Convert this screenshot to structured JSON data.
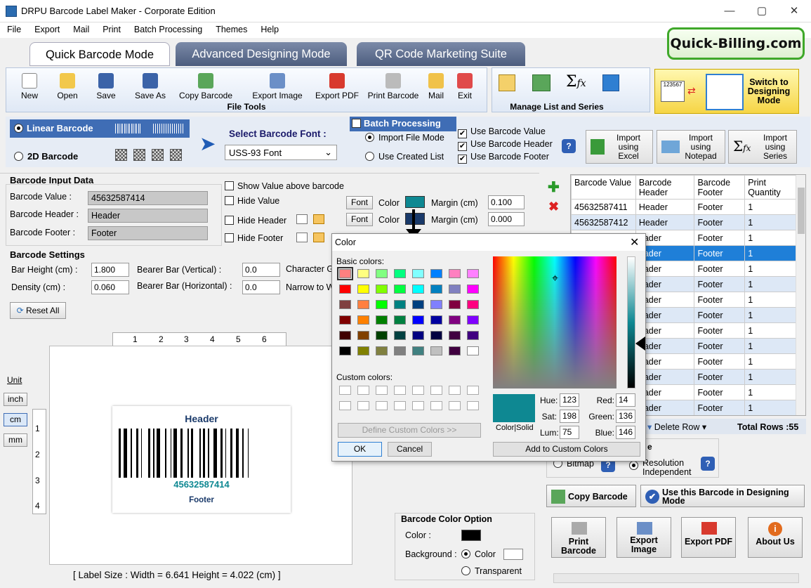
{
  "window": {
    "title": "DRPU Barcode Label Maker - Corporate Edition",
    "minimize": "—",
    "maximize": "▢",
    "close": "✕"
  },
  "menu": [
    "File",
    "Export",
    "Mail",
    "Print",
    "Batch Processing",
    "Themes",
    "Help"
  ],
  "tabs": [
    "Quick Barcode Mode",
    "Advanced Designing Mode",
    "QR Code Marketing Suite"
  ],
  "quick_billing": "Quick-Billing.com",
  "toolbar": {
    "items": [
      "New",
      "Open",
      "Save",
      "Save As",
      "Copy Barcode",
      "Export Image",
      "Export PDF",
      "Print Barcode",
      "Mail",
      "Exit"
    ],
    "group_label": "File Tools",
    "manage_label": "Manage List and Series"
  },
  "switch": {
    "label": "Switch to Designing Mode",
    "thumb": "123567"
  },
  "barcode_type": {
    "linear": "Linear Barcode",
    "twod": "2D Barcode"
  },
  "font": {
    "label": "Select Barcode Font :",
    "value": "USS-93 Font"
  },
  "batch": {
    "header": "Batch Processing",
    "import_file": "Import File Mode",
    "use_created": "Use Created List",
    "use_value": "Use Barcode Value",
    "use_header": "Use Barcode Header",
    "use_footer": "Use Barcode Footer",
    "help": "?",
    "import_excel": "Import using Excel",
    "import_notepad": "Import using Notepad",
    "import_series": "Import using Series"
  },
  "input": {
    "section": "Barcode Input Data",
    "value_label": "Barcode Value :",
    "value": "45632587414",
    "header_label": "Barcode Header :",
    "header": "Header",
    "footer_label": "Barcode Footer :",
    "footer": "Footer",
    "show_above": "Show Value above barcode",
    "hide_value": "Hide Value",
    "hide_header": "Hide Header",
    "hide_footer": "Hide Footer",
    "font_btn": "Font",
    "color_lbl": "Color",
    "margin_lbl": "Margin (cm)",
    "margin1": "0.100",
    "margin2": "0.000"
  },
  "settings": {
    "section": "Barcode Settings",
    "bar_height_lbl": "Bar Height (cm) :",
    "bar_height": "1.800",
    "density_lbl": "Density (cm) :",
    "density": "0.060",
    "bearer_v_lbl": "Bearer Bar (Vertical) :",
    "bearer_v": "0.0",
    "bearer_h_lbl": "Bearer Bar (Horizontal) :",
    "bearer_h": "0.0",
    "char_lbl": "Character G",
    "narrow_lbl": "Narrow to W",
    "reset": "Reset All"
  },
  "unit": {
    "label": "Unit",
    "options": [
      "inch",
      "cm",
      "mm"
    ],
    "selected": "cm"
  },
  "ruler": {
    "h": [
      "1",
      "2",
      "3",
      "4",
      "5",
      "6"
    ],
    "v": [
      "1",
      "2",
      "3",
      "4"
    ]
  },
  "label": {
    "header": "Header",
    "value": "45632587414",
    "footer": "Footer"
  },
  "label_size": "[ Label Size : Width = 6.641  Height = 4.022 (cm) ]",
  "color_option": {
    "title": "Barcode Color Option",
    "color_lbl": "Color :",
    "bg_lbl": "Background :",
    "color_radio": "Color",
    "transparent": "Transparent"
  },
  "table": {
    "headers": [
      "Barcode Value",
      "Barcode Header",
      "Barcode Footer",
      "Print Quantity"
    ],
    "rows": [
      [
        "45632587411",
        "Header",
        "Footer",
        "1"
      ],
      [
        "45632587412",
        "Header",
        "Footer",
        "1"
      ],
      [
        "",
        "eader",
        "Footer",
        "1"
      ],
      [
        "",
        "eader",
        "Footer",
        "1"
      ],
      [
        "",
        "eader",
        "Footer",
        "1"
      ],
      [
        "",
        "eader",
        "Footer",
        "1"
      ],
      [
        "",
        "eader",
        "Footer",
        "1"
      ],
      [
        "",
        "eader",
        "Footer",
        "1"
      ],
      [
        "",
        "eader",
        "Footer",
        "1"
      ],
      [
        "",
        "eader",
        "Footer",
        "1"
      ],
      [
        "",
        "eader",
        "Footer",
        "1"
      ],
      [
        "",
        "eader",
        "Footer",
        "1"
      ],
      [
        "",
        "eader",
        "Footer",
        "1"
      ],
      [
        "",
        "eader",
        "Footer",
        "1"
      ]
    ],
    "delete_row": "Delete Row",
    "total_rows": "Total Rows :55"
  },
  "image_type": {
    "bitmap": "Bitmap",
    "resolution": "Resolution Independent",
    "section_suffix": "e"
  },
  "copy_barcode": "Copy Barcode",
  "use_in_designing": "Use this Barcode in Designing Mode",
  "bottom_buttons": [
    "Print Barcode",
    "Export Image",
    "Export PDF",
    "About Us"
  ],
  "dialog": {
    "title": "Color",
    "basic": "Basic colors:",
    "custom": "Custom colors:",
    "define": "Define Custom Colors >>",
    "ok": "OK",
    "cancel": "Cancel",
    "add": "Add to Custom Colors",
    "color_solid": "Color|Solid",
    "hue_lbl": "Hue:",
    "hue": "123",
    "sat_lbl": "Sat:",
    "sat": "198",
    "lum_lbl": "Lum:",
    "lum": "75",
    "red_lbl": "Red:",
    "red": "14",
    "green_lbl": "Green:",
    "green": "136",
    "blue_lbl": "Blue:",
    "blue": "146",
    "basic_colors": [
      "#ff8080",
      "#ffff80",
      "#80ff80",
      "#00ff80",
      "#80ffff",
      "#0080ff",
      "#ff80c0",
      "#ff80ff",
      "#ff0000",
      "#ffff00",
      "#80ff00",
      "#00ff40",
      "#00ffff",
      "#0080c0",
      "#8080c0",
      "#ff00ff",
      "#804040",
      "#ff8040",
      "#00ff00",
      "#008080",
      "#004080",
      "#8080ff",
      "#800040",
      "#ff0080",
      "#800000",
      "#ff8000",
      "#008000",
      "#008040",
      "#0000ff",
      "#0000a0",
      "#800080",
      "#8000ff",
      "#400000",
      "#804000",
      "#004000",
      "#004040",
      "#000080",
      "#000040",
      "#400040",
      "#400080",
      "#000000",
      "#808000",
      "#808040",
      "#808080",
      "#408080",
      "#c0c0c0",
      "#400040",
      "#ffffff"
    ],
    "selected_color": "#0e8892"
  },
  "colors": {
    "accent": "#3f6db5",
    "selection": "#1f7fd8",
    "barcode_color": "#0e8892"
  }
}
